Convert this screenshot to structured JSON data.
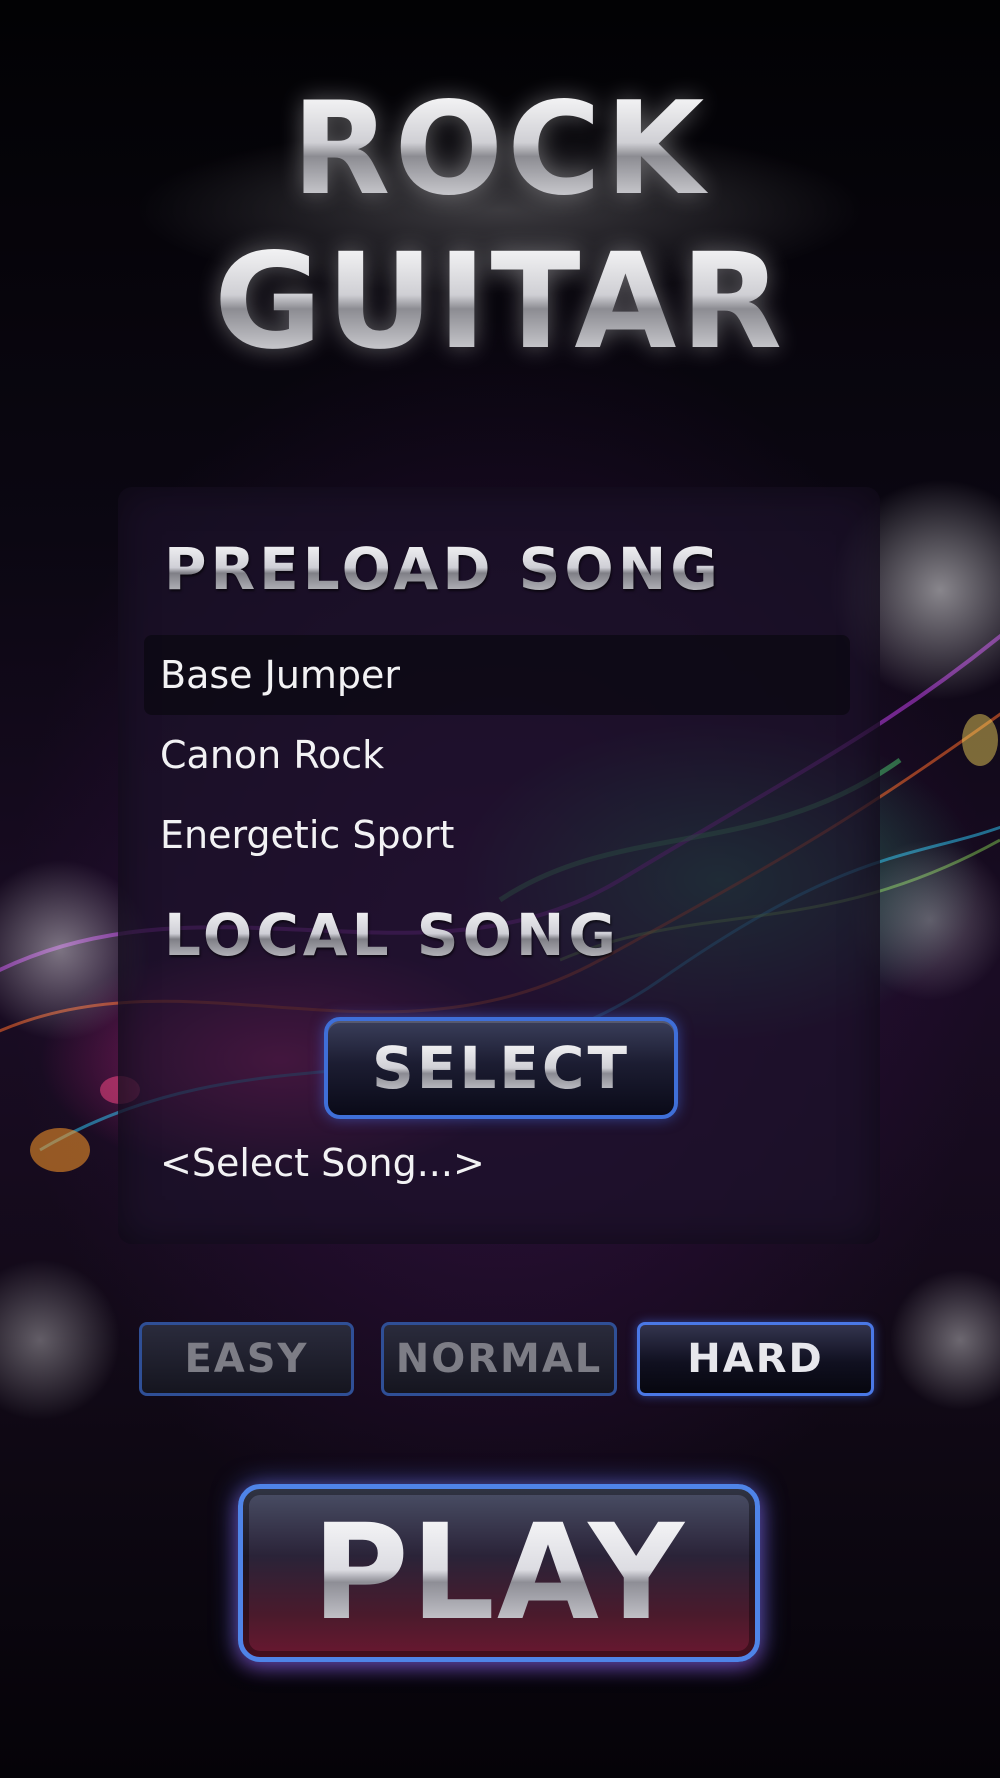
{
  "title": {
    "line1": "ROCK",
    "line2": "GUITAR"
  },
  "song_panel": {
    "preload_heading": "PRELOAD SONG",
    "preload_songs": [
      {
        "label": "Base Jumper",
        "selected": true
      },
      {
        "label": "Canon Rock",
        "selected": false
      },
      {
        "label": "Energetic Sport",
        "selected": false
      }
    ],
    "local_heading": "LOCAL SONG",
    "select_button_label": "SELECT",
    "selected_song_text": "<Select Song...>"
  },
  "difficulty": {
    "options": [
      {
        "label": "EASY",
        "active": false
      },
      {
        "label": "NORMAL",
        "active": false
      },
      {
        "label": "HARD",
        "active": true
      }
    ]
  },
  "play_button_label": "PLAY",
  "colors": {
    "accent_blue": "#4a78e6",
    "panel_bg": "#1c122a",
    "text": "#f2f2f4"
  }
}
